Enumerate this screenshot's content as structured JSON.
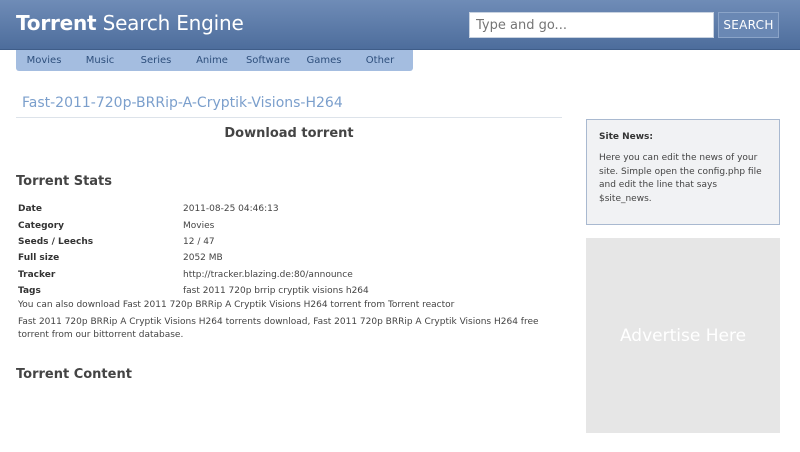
{
  "site": {
    "logo_bold": "Torrent",
    "logo_rest": " Search Engine"
  },
  "search": {
    "placeholder": "Type and go...",
    "button_label": "SEARCH"
  },
  "nav": {
    "items": [
      "Movies",
      "Music",
      "Series",
      "Anime",
      "Software",
      "Games",
      "Other"
    ]
  },
  "page": {
    "title": "Fast-2011-720p-BRRip-A-Cryptik-Visions-H264",
    "download_label": "Download torrent"
  },
  "stats": {
    "heading": "Torrent Stats",
    "rows": [
      {
        "label": "Date",
        "value": "2011-08-25 04:46:13"
      },
      {
        "label": "Category",
        "value": "Movies"
      },
      {
        "label": "Seeds / Leechs",
        "value": "12 / 47"
      },
      {
        "label": "Full size",
        "value": "2052 MB"
      },
      {
        "label": "Tracker",
        "value": "http://tracker.blazing.de:80/announce"
      },
      {
        "label": "Tags",
        "value": "fast 2011 720p brrip cryptik visions h264"
      }
    ],
    "also_download": "You can also download Fast 2011 720p BRRip A Cryptik Visions H264 torrent from Torrent reactor",
    "description": "Fast 2011 720p BRRip A Cryptik Visions H264 torrents download, Fast 2011 720p BRRip A Cryptik Visions H264 free torrent from our bittorrent database."
  },
  "content": {
    "heading": "Torrent Content"
  },
  "sidebar": {
    "news_title": "Site News:",
    "news_body": "Here you can edit the news of your site. Simple open the config.php file and edit the line that says $site_news.",
    "ad_text": "Advertise Here"
  }
}
